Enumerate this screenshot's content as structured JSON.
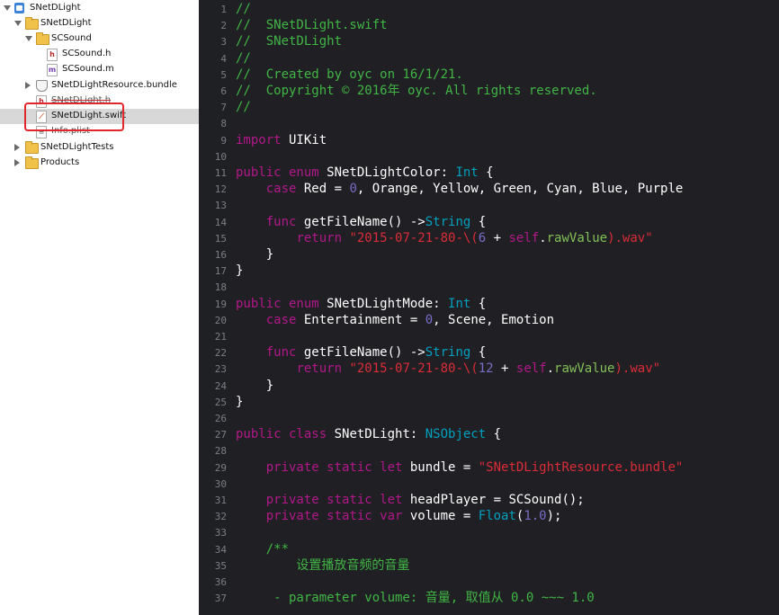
{
  "navigator": {
    "items": [
      {
        "label": "SNetDLight",
        "icon": "project-icon",
        "indent": 0,
        "disclosure": "open"
      },
      {
        "label": "SNetDLight",
        "icon": "folder-icon",
        "indent": 1,
        "disclosure": "open"
      },
      {
        "label": "SCSound",
        "icon": "folder-icon",
        "indent": 2,
        "disclosure": "open"
      },
      {
        "label": "SCSound.h",
        "icon": "header-file-icon",
        "indent": 3,
        "disclosure": "none"
      },
      {
        "label": "SCSound.m",
        "icon": "objc-file-icon",
        "indent": 3,
        "disclosure": "none"
      },
      {
        "label": "SNetDLightResource.bundle",
        "icon": "bundle-icon",
        "indent": 2,
        "disclosure": "closed"
      },
      {
        "label": "SNetDLight.h",
        "icon": "header-file-icon",
        "indent": 2,
        "disclosure": "none"
      },
      {
        "label": "SNetDLight.swift",
        "icon": "swift-file-icon",
        "indent": 2,
        "disclosure": "none",
        "selected": true
      },
      {
        "label": "Info.plist",
        "icon": "plist-file-icon",
        "indent": 2,
        "disclosure": "none"
      },
      {
        "label": "SNetDLightTests",
        "icon": "folder-icon",
        "indent": 1,
        "disclosure": "closed"
      },
      {
        "label": "Products",
        "icon": "folder-icon",
        "indent": 1,
        "disclosure": "closed"
      }
    ],
    "icon_glyphs": {
      "header": "h",
      "objc": "m",
      "swift": "⟋",
      "plist": "≡"
    }
  },
  "colors": {
    "comment": "#41b645",
    "keyword": "#b21889",
    "type": "#00a0be",
    "number": "#786dc4",
    "string": "#db2c38",
    "plain": "#ffffff",
    "highlight_box": "#e0262a"
  },
  "editor": {
    "lines": [
      [
        [
          "c",
          "//"
        ]
      ],
      [
        [
          "c",
          "//  SNetDLight.swift"
        ]
      ],
      [
        [
          "c",
          "//  SNetDLight"
        ]
      ],
      [
        [
          "c",
          "//"
        ]
      ],
      [
        [
          "c",
          "//  Created by oyc on 16/1/21."
        ]
      ],
      [
        [
          "c",
          "//  Copyright © 2016年 oyc. All rights reserved."
        ]
      ],
      [
        [
          "c",
          "//"
        ]
      ],
      [],
      [
        [
          "k",
          "import"
        ],
        [
          "p",
          " UIKit"
        ]
      ],
      [],
      [
        [
          "k",
          "public enum"
        ],
        [
          "p",
          " SNetDLightColor: "
        ],
        [
          "t",
          "Int"
        ],
        [
          "p",
          " {"
        ]
      ],
      [
        [
          "p",
          "    "
        ],
        [
          "k",
          "case"
        ],
        [
          "p",
          " Red = "
        ],
        [
          "n",
          "0"
        ],
        [
          "p",
          ", Orange, Yellow, Green, Cyan, Blue, Purple"
        ]
      ],
      [],
      [
        [
          "p",
          "    "
        ],
        [
          "k",
          "func"
        ],
        [
          "p",
          " getFileName() ->"
        ],
        [
          "t",
          "String"
        ],
        [
          "p",
          " {"
        ]
      ],
      [
        [
          "p",
          "        "
        ],
        [
          "k",
          "return"
        ],
        [
          "s",
          " \"2015-07-21-80-\\("
        ],
        [
          "n",
          "6"
        ],
        [
          "p",
          " + "
        ],
        [
          "k",
          "self"
        ],
        [
          "p",
          "."
        ],
        [
          "f",
          "rawValue"
        ],
        [
          "s",
          ").wav\""
        ]
      ],
      [
        [
          "p",
          "    }"
        ]
      ],
      [
        [
          "p",
          "}"
        ]
      ],
      [],
      [
        [
          "k",
          "public enum"
        ],
        [
          "p",
          " SNetDLightMode: "
        ],
        [
          "t",
          "Int"
        ],
        [
          "p",
          " {"
        ]
      ],
      [
        [
          "p",
          "    "
        ],
        [
          "k",
          "case"
        ],
        [
          "p",
          " Entertainment = "
        ],
        [
          "n",
          "0"
        ],
        [
          "p",
          ", Scene, Emotion"
        ]
      ],
      [],
      [
        [
          "p",
          "    "
        ],
        [
          "k",
          "func"
        ],
        [
          "p",
          " getFileName() ->"
        ],
        [
          "t",
          "String"
        ],
        [
          "p",
          " {"
        ]
      ],
      [
        [
          "p",
          "        "
        ],
        [
          "k",
          "return"
        ],
        [
          "s",
          " \"2015-07-21-80-\\("
        ],
        [
          "n",
          "12"
        ],
        [
          "p",
          " + "
        ],
        [
          "k",
          "self"
        ],
        [
          "p",
          "."
        ],
        [
          "f",
          "rawValue"
        ],
        [
          "s",
          ").wav\""
        ]
      ],
      [
        [
          "p",
          "    }"
        ]
      ],
      [
        [
          "p",
          "}"
        ]
      ],
      [],
      [
        [
          "k",
          "public class"
        ],
        [
          "p",
          " SNetDLight: "
        ],
        [
          "t",
          "NSObject"
        ],
        [
          "p",
          " {"
        ]
      ],
      [],
      [
        [
          "p",
          "    "
        ],
        [
          "k",
          "private static let"
        ],
        [
          "p",
          " bundle = "
        ],
        [
          "s",
          "\"SNetDLightResource.bundle\""
        ]
      ],
      [],
      [
        [
          "p",
          "    "
        ],
        [
          "k",
          "private static let"
        ],
        [
          "p",
          " headPlayer = SCSound();"
        ]
      ],
      [
        [
          "p",
          "    "
        ],
        [
          "k",
          "private static var"
        ],
        [
          "p",
          " volume = "
        ],
        [
          "t",
          "Float"
        ],
        [
          "p",
          "("
        ],
        [
          "n",
          "1.0"
        ],
        [
          "p",
          ");"
        ]
      ],
      [],
      [
        [
          "p",
          "    "
        ],
        [
          "d",
          "/**"
        ]
      ],
      [
        [
          "d",
          "        设置播放音频的音量"
        ]
      ],
      [],
      [
        [
          "d",
          "     - parameter volume: 音量, 取值从 0.0 ~~~ 1.0"
        ]
      ]
    ]
  }
}
